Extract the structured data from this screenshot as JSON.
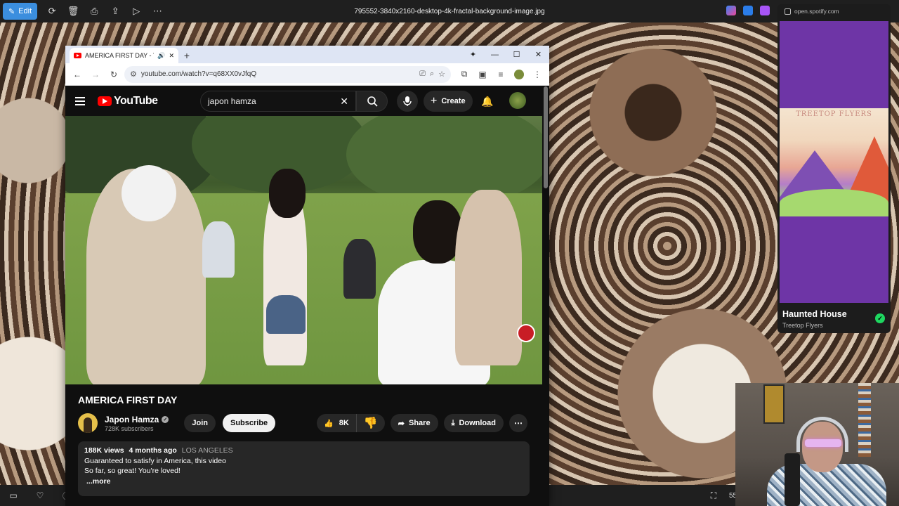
{
  "photos": {
    "edit_label": "Edit",
    "filename": "795552-3840x2160-desktop-4k-fractal-background-image.jpg",
    "zoom_partial": "55"
  },
  "browser": {
    "tab_title": "AMERICA FIRST DAY - YouTube",
    "url": "youtube.com/watch?v=q68XX0vJfqQ"
  },
  "youtube": {
    "logo_text": "YouTube",
    "search_value": "japon hamza",
    "create_label": "Create",
    "video_title": "AMERICA FIRST DAY",
    "channel_name": "Japon Hamza",
    "subscribers": "728K subscribers",
    "join_label": "Join",
    "subscribe_label": "Subscribe",
    "likes": "8K",
    "share_label": "Share",
    "download_label": "Download",
    "description": {
      "views": "188K views",
      "age": "4 months ago",
      "location": "LOS ANGELES",
      "line1": "Guaranteed to satisfy in America, this video",
      "line2": "So far, so great! You're loved!",
      "more": "...more"
    }
  },
  "spotify": {
    "url": "open.spotify.com",
    "cover_title": "TREETOP FLYERS",
    "track": "Haunted House",
    "artist": "Treetop Flyers",
    "colors": {
      "background": "#6e35a6",
      "accent": "#1ed760"
    }
  }
}
